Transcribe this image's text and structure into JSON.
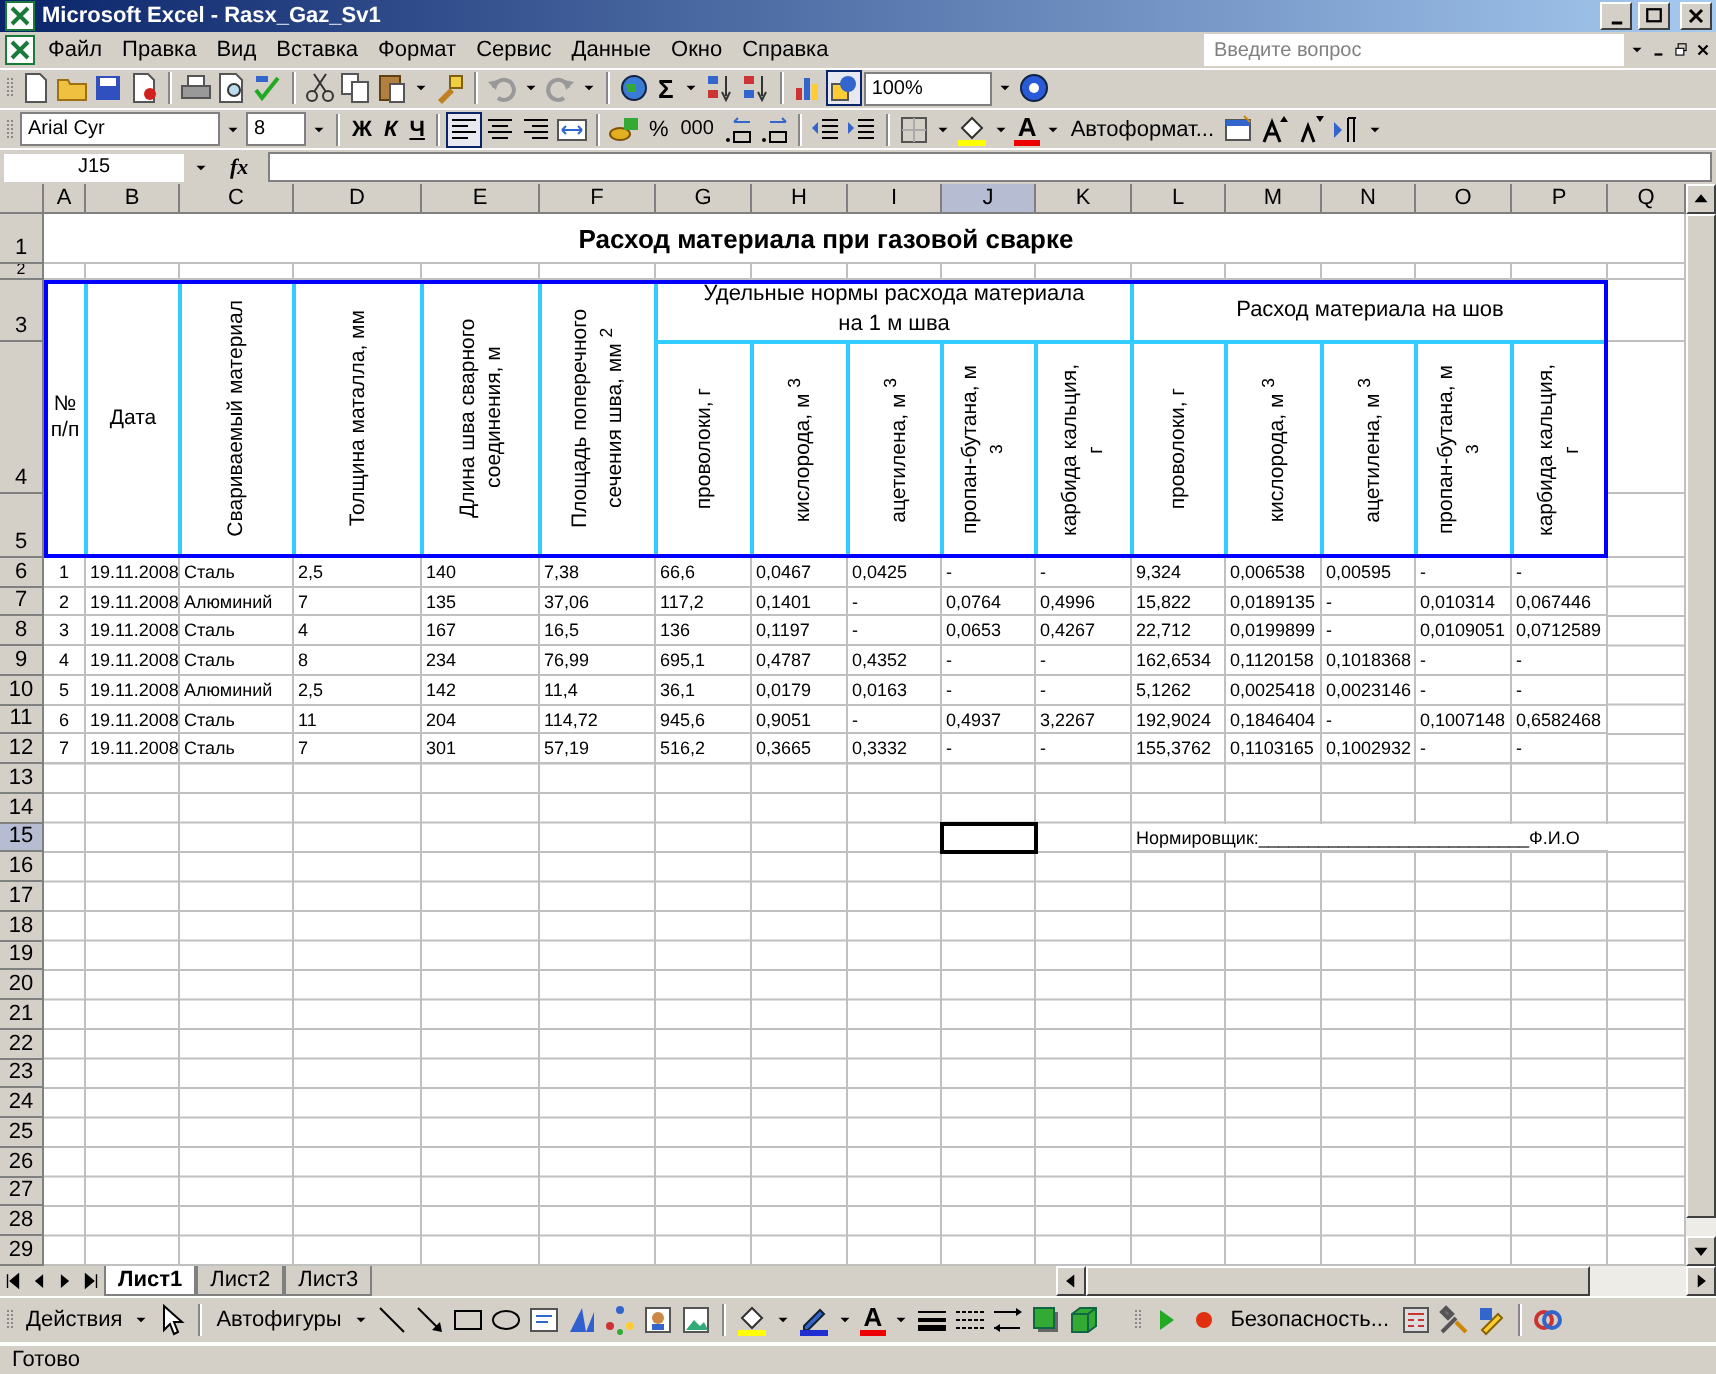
{
  "window": {
    "title": "Microsoft Excel - Rasx_Gaz_Sv1"
  },
  "menu": [
    "Файл",
    "Правка",
    "Вид",
    "Вставка",
    "Формат",
    "Сервис",
    "Данные",
    "Окно",
    "Справка"
  ],
  "help_search": {
    "placeholder": "Введите вопрос"
  },
  "standard_toolbar": {
    "autosum": "Σ",
    "zoom": "100%"
  },
  "formatting_toolbar": {
    "font": "Arial Cyr",
    "size": "8",
    "bold": "Ж",
    "italic": "К",
    "underline": "Ч",
    "percent": "%",
    "thousands": "000",
    "font_color": "A",
    "autoformat": "Автоформат..."
  },
  "formula_bar": {
    "name_box": "J15",
    "fx": "fx"
  },
  "columns": [
    {
      "letter": "A",
      "selected": false
    },
    {
      "letter": "B",
      "selected": false
    },
    {
      "letter": "C",
      "selected": false
    },
    {
      "letter": "D",
      "selected": false
    },
    {
      "letter": "E",
      "selected": false
    },
    {
      "letter": "F",
      "selected": false
    },
    {
      "letter": "G",
      "selected": false
    },
    {
      "letter": "H",
      "selected": false
    },
    {
      "letter": "I",
      "selected": false
    },
    {
      "letter": "J",
      "selected": true
    },
    {
      "letter": "K",
      "selected": false
    },
    {
      "letter": "L",
      "selected": false
    },
    {
      "letter": "M",
      "selected": false
    },
    {
      "letter": "N",
      "selected": false
    },
    {
      "letter": "O",
      "selected": false
    },
    {
      "letter": "P",
      "selected": false
    },
    {
      "letter": "Q",
      "selected": false
    }
  ],
  "rows": [
    {
      "number": "1",
      "selected": false
    },
    {
      "number": "2",
      "selected": false
    },
    {
      "number": "3",
      "selected": false
    },
    {
      "number": "4",
      "selected": false
    },
    {
      "number": "5",
      "selected": false
    },
    {
      "number": "6",
      "selected": false
    },
    {
      "number": "7",
      "selected": false
    },
    {
      "number": "8",
      "selected": false
    },
    {
      "number": "9",
      "selected": false
    },
    {
      "number": "10",
      "selected": false
    },
    {
      "number": "11",
      "selected": false
    },
    {
      "number": "12",
      "selected": false
    },
    {
      "number": "13",
      "selected": false
    },
    {
      "number": "14",
      "selected": false
    },
    {
      "number": "15",
      "selected": true
    },
    {
      "number": "16",
      "selected": false
    },
    {
      "number": "17",
      "selected": false
    },
    {
      "number": "18",
      "selected": false
    },
    {
      "number": "19",
      "selected": false
    },
    {
      "number": "20",
      "selected": false
    },
    {
      "number": "21",
      "selected": false
    },
    {
      "number": "22",
      "selected": false
    },
    {
      "number": "23",
      "selected": false
    },
    {
      "number": "24",
      "selected": false
    },
    {
      "number": "25",
      "selected": false
    },
    {
      "number": "26",
      "selected": false
    },
    {
      "number": "27",
      "selected": false
    },
    {
      "number": "28",
      "selected": false
    },
    {
      "number": "29",
      "selected": false
    }
  ],
  "sheet": {
    "title": "Расход материала при газовой сварке",
    "fixed_headers": [
      {
        "label": "№ п/п",
        "kind": "horizontal"
      },
      {
        "label": "Дата",
        "kind": "horizontal"
      },
      {
        "label": "Свариваемый материал",
        "kind": "vertical"
      },
      {
        "label": "Толщина маталла, мм",
        "kind": "vertical"
      },
      {
        "label": "Длина шва сварного соединения, м",
        "kind": "vertical"
      },
      {
        "label": "Площадь поперечного сечения шва, мм $^{2}$",
        "kind": "vertical"
      }
    ],
    "header_groups": [
      {
        "label": "Удельные нормы расхода материала на 1 м шва",
        "columns": [
          "проволоки, г",
          "кислорода, м $^{3}$",
          "ацетилена, м $^{3}$",
          "пропан-бутана, м $^{3}$",
          "карбида кальция, г"
        ]
      },
      {
        "label": "Расход материала на шов",
        "columns": [
          "проволоки, г",
          "кислорода, м $^{3}$",
          "ацетилена, м $^{3}$",
          "пропан-бутана, м $^{3}$",
          "карбида кальция, г"
        ]
      }
    ],
    "data": [
      [
        "1",
        "19.11.2008",
        "Сталь",
        "2,5",
        "140",
        "7,38",
        "66,6",
        "0,0467",
        "0,0425",
        "-",
        "-",
        "9,324",
        "0,006538",
        "0,00595",
        "-",
        "-"
      ],
      [
        "2",
        "19.11.2008",
        "Алюминий",
        "7",
        "135",
        "37,06",
        "117,2",
        "0,1401",
        "-",
        "0,0764",
        "0,4996",
        "15,822",
        "0,0189135",
        "-",
        "0,010314",
        "0,067446"
      ],
      [
        "3",
        "19.11.2008",
        "Сталь",
        "4",
        "167",
        "16,5",
        "136",
        "0,1197",
        "-",
        "0,0653",
        "0,4267",
        "22,712",
        "0,0199899",
        "-",
        "0,0109051",
        "0,0712589"
      ],
      [
        "4",
        "19.11.2008",
        "Сталь",
        "8",
        "234",
        "76,99",
        "695,1",
        "0,4787",
        "0,4352",
        "-",
        "-",
        "162,6534",
        "0,1120158",
        "0,1018368",
        "-",
        "-"
      ],
      [
        "5",
        "19.11.2008",
        "Алюминий",
        "2,5",
        "142",
        "11,4",
        "36,1",
        "0,0179",
        "0,0163",
        "-",
        "-",
        "5,1262",
        "0,0025418",
        "0,0023146",
        "-",
        "-"
      ],
      [
        "6",
        "19.11.2008",
        "Сталь",
        "11",
        "204",
        "114,72",
        "945,6",
        "0,9051",
        "-",
        "0,4937",
        "3,2267",
        "192,9024",
        "0,1846404",
        "-",
        "0,1007148",
        "0,6582468"
      ],
      [
        "7",
        "19.11.2008",
        "Сталь",
        "7",
        "301",
        "57,19",
        "516,2",
        "0,3665",
        "0,3332",
        "-",
        "-",
        "155,3762",
        "0,1103165",
        "0,1002932",
        "-",
        "-"
      ]
    ],
    "signature": "Нормировщик:___________________________Ф.И.О"
  },
  "sheet_tabs": [
    {
      "label": "Лист1",
      "selected": true
    },
    {
      "label": "Лист2",
      "selected": false
    },
    {
      "label": "Лист3",
      "selected": false
    }
  ],
  "drawing_toolbar": {
    "actions": "Действия",
    "autoshapes": "Автофигуры",
    "font_color": "A",
    "security": "Безопасность..."
  },
  "status_bar": "Готово"
}
